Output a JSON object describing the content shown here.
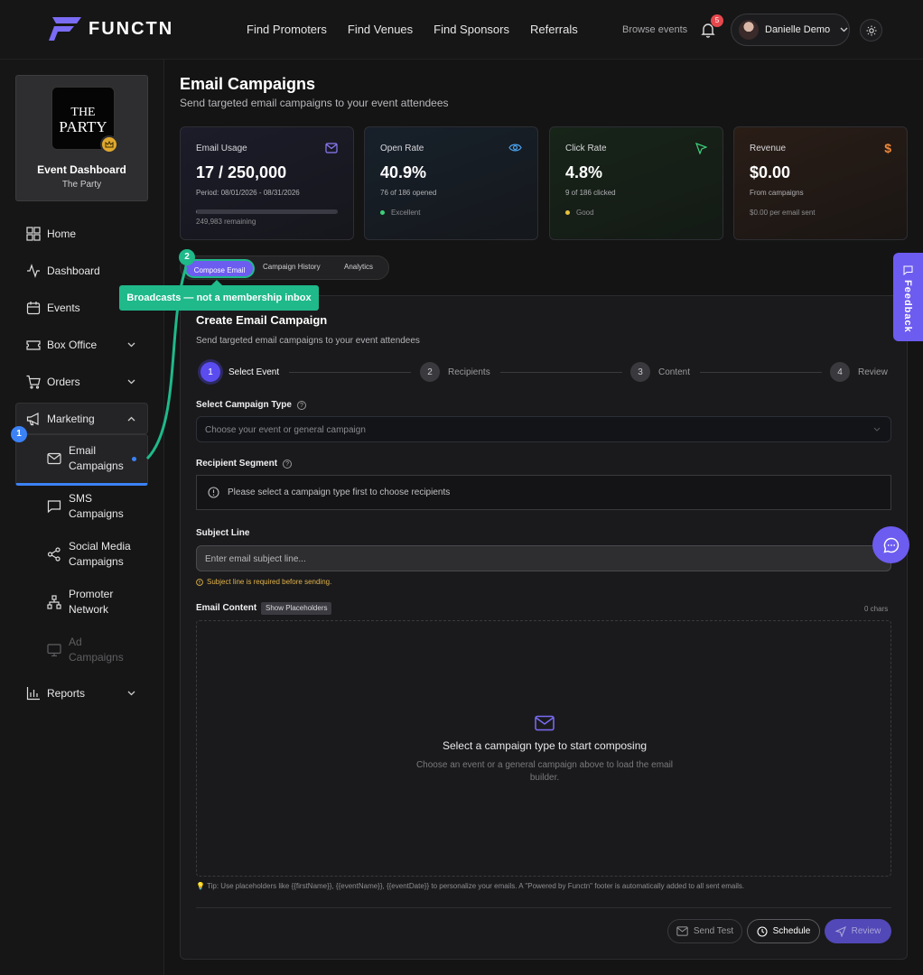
{
  "app": {
    "brand": "FUNCTN"
  },
  "nav": {
    "links": [
      "Find Promoters",
      "Find Venues",
      "Find Sponsors",
      "Referrals"
    ],
    "browse": "Browse events",
    "notifications": "5",
    "user": "Danielle Demo"
  },
  "sidebar": {
    "event": {
      "image_text_1": "THE",
      "image_text_2": "PARTY",
      "title": "Event Dashboard",
      "subtitle": "The Party"
    },
    "items": {
      "home": "Home",
      "dashboard": "Dashboard",
      "events": "Events",
      "box_office": "Box Office",
      "orders": "Orders",
      "marketing": "Marketing",
      "reports": "Reports"
    },
    "marketing_sub": {
      "email": "Email Campaigns",
      "sms": "SMS Campaigns",
      "social": "Social Media Campaigns",
      "promoter": "Promoter Network",
      "ad": "Ad Campaigns"
    }
  },
  "page": {
    "title": "Email Campaigns",
    "subtitle": "Send targeted email campaigns to your event attendees"
  },
  "stats": {
    "usage": {
      "label": "Email Usage",
      "value": "17 / 250,000",
      "sub": "Period: 08/01/2026 - 08/31/2026",
      "foot": "249,983 remaining",
      "progress": 0.0001
    },
    "open": {
      "label": "Open Rate",
      "value": "40.9%",
      "sub": "76 of 186 opened",
      "foot": "Excellent"
    },
    "click": {
      "label": "Click Rate",
      "value": "4.8%",
      "sub": "9 of 186 clicked",
      "foot": "Good"
    },
    "revenue": {
      "label": "Revenue",
      "value": "$0.00",
      "sub": "From campaigns",
      "foot": "$0.00 per email sent"
    }
  },
  "tabs": [
    "Compose Email",
    "Campaign History",
    "Analytics"
  ],
  "form": {
    "title": "Create Email Campaign",
    "subtitle": "Send targeted email campaigns to your event attendees",
    "steps": [
      {
        "num": "1",
        "label": "Select Event"
      },
      {
        "num": "2",
        "label": "Recipients"
      },
      {
        "num": "3",
        "label": "Content"
      },
      {
        "num": "4",
        "label": "Review"
      }
    ],
    "campaign_type_label": "Select Campaign Type",
    "campaign_type_placeholder": "Choose your event or general campaign",
    "segment_label": "Recipient Segment",
    "segment_info": "Please select a campaign type first to choose recipients",
    "subject_label": "Subject Line",
    "subject_placeholder": "Enter email subject line...",
    "subject_warning": "Subject line is required before sending.",
    "content_label": "Email Content",
    "show_placeholders": "Show Placeholders",
    "chars": "0 chars",
    "editor_title": "Select a campaign type to start composing",
    "editor_sub": "Choose an event or a general campaign above to load the email builder.",
    "tip": "💡 Tip: Use placeholders like {{firstName}}, {{eventName}}, {{eventDate}} to personalize your emails. A \"Powered by Functn\" footer is automatically added to all sent emails.",
    "buttons": {
      "test": "Send Test",
      "schedule": "Schedule",
      "review": "Review"
    }
  },
  "overlay": {
    "feedback": "Feedback",
    "tooltip": "Broadcasts — not a membership inbox",
    "marker1": "1",
    "marker2": "2"
  },
  "colors": {
    "accent": "#6d5cf0",
    "annotation": "#1fb98a",
    "marker_blue": "#3b82f6",
    "badge": "#e5484d"
  }
}
